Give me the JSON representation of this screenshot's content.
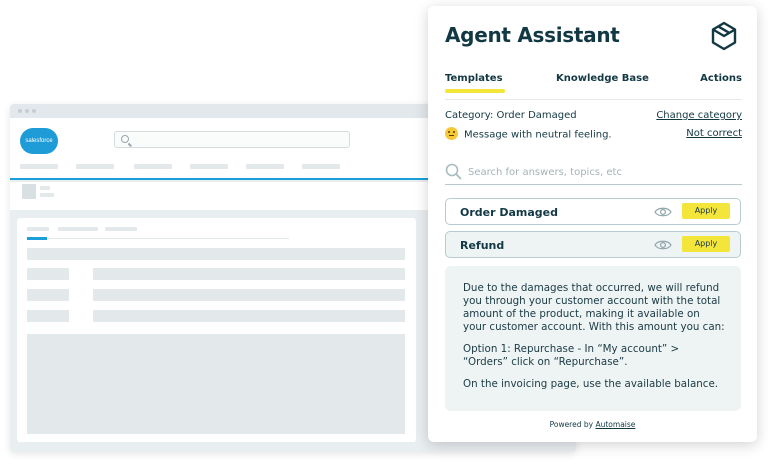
{
  "panel": {
    "title": "Agent Assistant",
    "logo_icon": "automaise-hexagon-logo-icon",
    "tabs": [
      {
        "label": "Templates",
        "active": true
      },
      {
        "label": "Knowledge Base",
        "active": false
      },
      {
        "label": "Actions",
        "active": false
      }
    ],
    "category_text": "Category: Order Damaged",
    "change_category_link": "Change category",
    "sentiment_icon": "neutral-face-emoji-icon",
    "sentiment_text": "Message with neutral feeling.",
    "not_correct_link": "Not correct",
    "search_placeholder": "Search for answers, topics, etc",
    "templates": [
      {
        "label": "Order Damaged",
        "apply_label": "Apply"
      },
      {
        "label": "Refund",
        "apply_label": "Apply"
      }
    ],
    "preview_paragraphs": [
      "Due to the damages that occurred, we will refund you through your customer account with the total amount of the product, making it available on your customer account. With this amount you can:",
      "Option 1: Repurchase - In “My account” > “Orders” click on “Repurchase”.",
      "On the invoicing page, use the available balance."
    ],
    "powered_prefix": "Powered by",
    "powered_brand": "Automaise"
  },
  "background_app": {
    "logo_text": "salesforce"
  },
  "colors": {
    "accent_yellow": "#f4e53b",
    "text_dark": "#123844",
    "salesforce_blue": "#1e9cd7"
  }
}
